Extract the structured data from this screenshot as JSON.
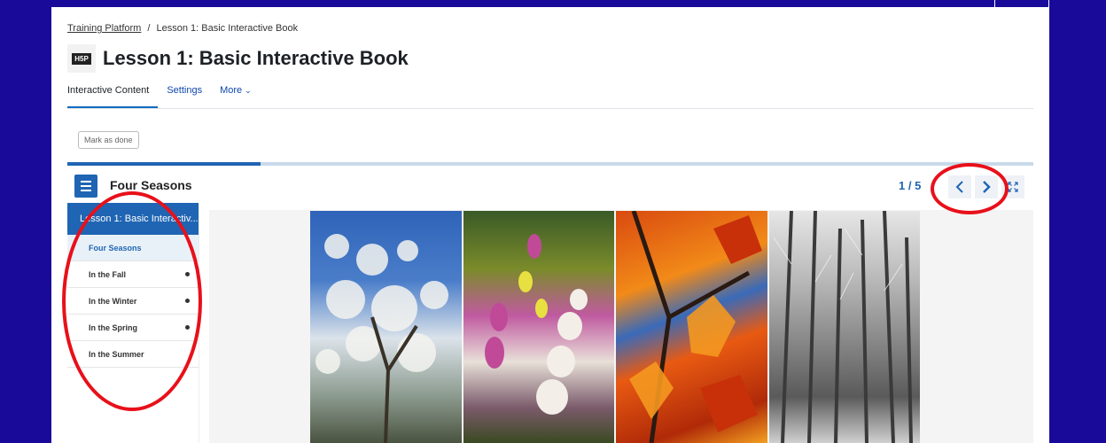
{
  "breadcrumb": {
    "root": "Training Platform",
    "separator": "/",
    "current": "Lesson 1: Basic Interactive Book"
  },
  "header": {
    "logo_text": "H5P",
    "title": "Lesson 1: Basic Interactive Book"
  },
  "tabs": [
    {
      "label": "Interactive Content",
      "active": true
    },
    {
      "label": "Settings",
      "active": false
    },
    {
      "label": "More",
      "active": false
    }
  ],
  "mark_done_label": "Mark as done",
  "book": {
    "chapter_title": "Four Seasons",
    "page_indicator": "1 / 5",
    "progress_fraction": 0.2,
    "sidebar_title": "Lesson 1: Basic Interactiv...",
    "chapters": [
      {
        "label": "Four Seasons",
        "current": true
      },
      {
        "label": "In the Fall",
        "current": false
      },
      {
        "label": "In the Winter",
        "current": false
      },
      {
        "label": "In the Spring",
        "current": false
      },
      {
        "label": "In the Summer",
        "current": false
      }
    ],
    "nav": {
      "prev_icon": "chevron-left-icon",
      "next_icon": "chevron-right-icon",
      "fullscreen_icon": "fullscreen-icon"
    }
  },
  "colors": {
    "background": "#1a0a9a",
    "accent": "#1f65b3",
    "annotation": "#e8101a"
  }
}
